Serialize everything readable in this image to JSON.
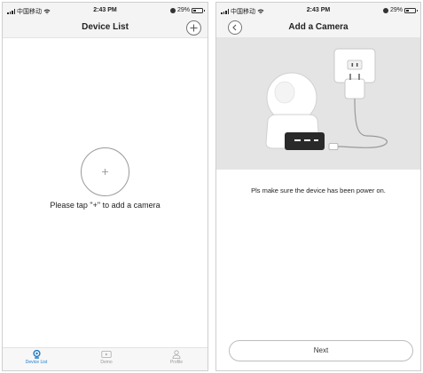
{
  "device_list_screen": {
    "status_bar": {
      "carrier": "中国移动",
      "time": "2:43 PM",
      "battery": "29%"
    },
    "title": "Device List",
    "empty_hint": "Please tap \"+\"  to add a camera",
    "tabs": [
      {
        "label": "Device List",
        "icon": "camera-icon",
        "active": true
      },
      {
        "label": "Demo",
        "icon": "video-icon",
        "active": false
      },
      {
        "label": "Profile",
        "icon": "person-icon",
        "active": false
      }
    ]
  },
  "add_camera_screen": {
    "status_bar": {
      "carrier": "中国移动",
      "time": "2:43 PM",
      "battery": "29%"
    },
    "title": "Add a Camera",
    "power_note": "Pls make sure the device has been power on.",
    "next_label": "Next"
  },
  "colors": {
    "accent": "#1e7ac8",
    "status_bar_bg": "#f4f4f4",
    "illustration_bg": "#e4e4e4"
  }
}
